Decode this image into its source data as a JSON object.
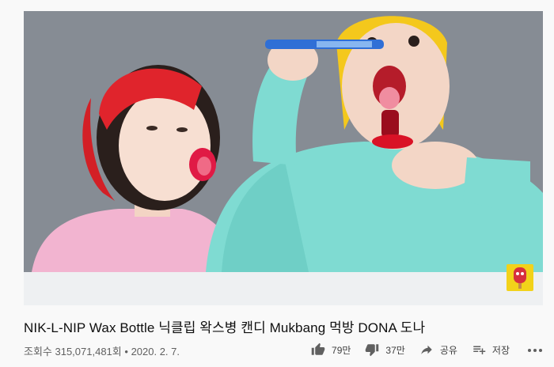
{
  "video": {
    "title": "NIK-L-NIP Wax Bottle 닉클립 왁스병 캔디 Mukbang 먹방 DONA 도나",
    "view_count": "조회수 315,071,481회",
    "separator": "•",
    "date": "2020. 2. 7."
  },
  "actions": {
    "like_count": "79만",
    "dislike_count": "37만",
    "share_label": "공유",
    "save_label": "저장"
  },
  "icons": {
    "like": "thumbs-up-icon",
    "dislike": "thumbs-down-icon",
    "share": "share-arrow-icon",
    "save": "playlist-add-icon",
    "more": "more-horizontal-icon"
  },
  "colors": {
    "page_bg": "#f9f9f9",
    "title_text": "#0f0f0f",
    "meta_text": "#606060",
    "watermark_bg": "#f2d21a"
  }
}
